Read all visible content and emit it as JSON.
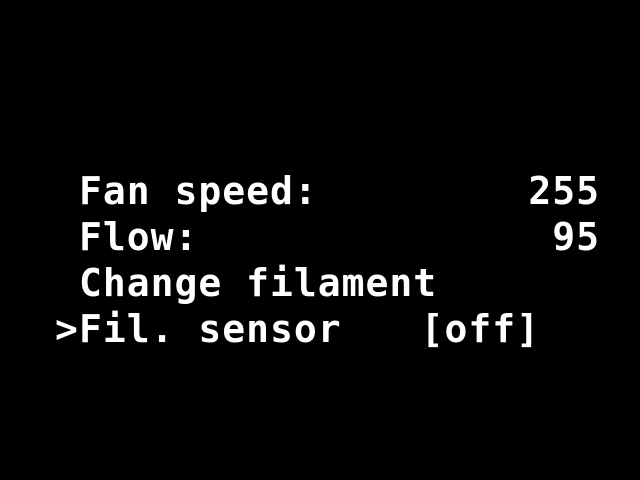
{
  "menu": {
    "items": [
      {
        "cursor": "",
        "label": "Fan speed:",
        "value": "255"
      },
      {
        "cursor": "",
        "label": "Flow:",
        "value": "95"
      },
      {
        "cursor": "",
        "label": "Change filament",
        "value": ""
      },
      {
        "cursor": ">",
        "label": "Fil. sensor",
        "value": "[off]"
      }
    ]
  },
  "colors": {
    "background": "#000000",
    "text": "#FFFFFF"
  }
}
